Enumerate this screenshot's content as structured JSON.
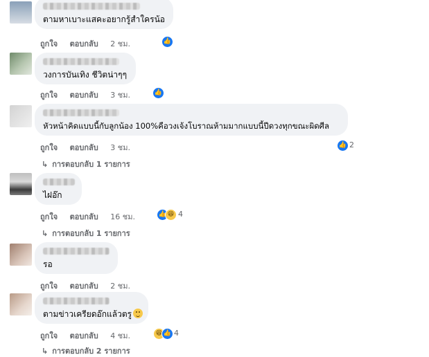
{
  "comments": [
    {
      "text": "ตามหาเบาะแสคะอยากรู้สำใครน้อ",
      "like": "ถูกใจ",
      "reply": "ตอบกลับ",
      "time": "2 ชม."
    },
    {
      "text": "วงการบันเทิง ชีวิตน่าๆๆ",
      "like": "ถูกใจ",
      "reply": "ตอบกลับ",
      "time": "3 ชม."
    },
    {
      "text": "หัวหน้าคิดแบบนี้กับลูกน้อง 100%คือวงเจ้งโบราณห้ามมากแบบนี้ปีดวงทุกขณะผิดศีล",
      "like": "ถูกใจ",
      "reply": "ตอบกลับ",
      "time": "3 ชม.",
      "reaction_count": "2",
      "replies": "การตอบกลับ 1 รายการ"
    },
    {
      "text": "ไฝอ๊ก",
      "like": "ถูกใจ",
      "reply": "ตอบกลับ",
      "time": "16 ชม.",
      "reaction_count": "4",
      "replies": "การตอบกลับ 1 รายการ"
    },
    {
      "text": "รอ",
      "like": "ถูกใจ",
      "reply": "ตอบกลับ",
      "time": "2 ชม."
    },
    {
      "text": "ตามข่าวเครียดอ๊กแล้วตรู",
      "like": "ถูกใจ",
      "reply": "ตอบกลับ",
      "time": "4 ชม.",
      "reaction_count": "4",
      "replies": "การตอบกลับ 2 รายการ"
    }
  ],
  "icons": {
    "like": "like-icon",
    "haha": "haha-icon",
    "reply_arrow": "reply-arrow-icon"
  },
  "colors": {
    "bubble": "#f0f2f5",
    "like_blue": "#1877f2",
    "haha_yellow": "#f7c94b",
    "meta_gray": "#65676b"
  }
}
